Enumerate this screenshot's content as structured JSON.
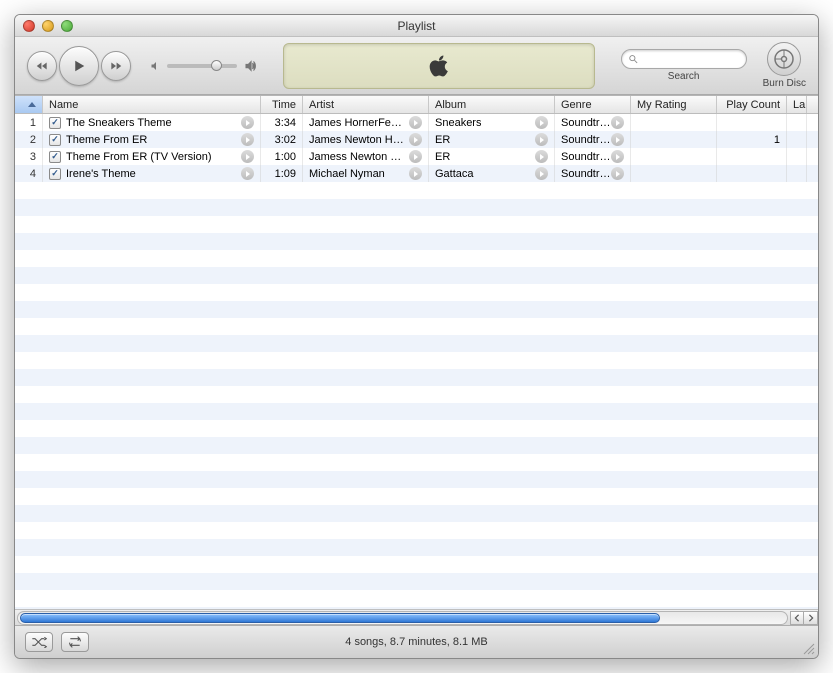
{
  "window": {
    "title": "Playlist"
  },
  "toolbar": {
    "search_label": "Search",
    "search_placeholder": "",
    "burn_label": "Burn Disc"
  },
  "columns": {
    "num": "",
    "name": "Name",
    "time": "Time",
    "artist": "Artist",
    "album": "Album",
    "genre": "Genre",
    "rating": "My Rating",
    "count": "Play Count",
    "last": "La"
  },
  "tracks": [
    {
      "num": "1",
      "checked": true,
      "name": "The Sneakers Theme",
      "time": "3:34",
      "artist": "James HornerFe…",
      "album": "Sneakers",
      "genre": "Soundtrack",
      "rating": "",
      "count": ""
    },
    {
      "num": "2",
      "checked": true,
      "name": "Theme From ER",
      "time": "3:02",
      "artist": "James Newton H…",
      "album": "ER",
      "genre": "Soundtrack",
      "rating": "",
      "count": "1"
    },
    {
      "num": "3",
      "checked": true,
      "name": "Theme From ER (TV Version)",
      "time": "1:00",
      "artist": "Jamess Newton …",
      "album": "ER",
      "genre": "Soundtrack",
      "rating": "",
      "count": ""
    },
    {
      "num": "4",
      "checked": true,
      "name": "Irene's Theme",
      "time": "1:09",
      "artist": "Michael Nyman",
      "album": "Gattaca",
      "genre": "Soundtrack",
      "rating": "",
      "count": ""
    }
  ],
  "status": {
    "summary": "4 songs, 8.7 minutes, 8.1 MB"
  }
}
